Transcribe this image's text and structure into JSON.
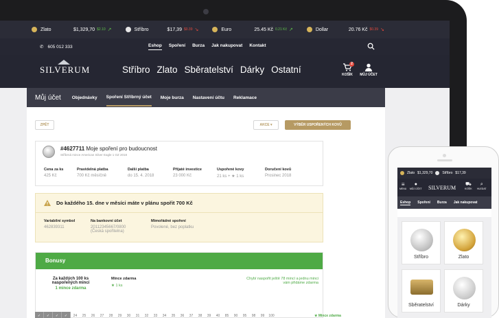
{
  "ticker": [
    {
      "name": "Zlato",
      "price": "$1,329,70",
      "change": "$2.10",
      "dir": "up",
      "color": "#d6b45a"
    },
    {
      "name": "Stříbro",
      "price": "$17,39",
      "change": "$0.39",
      "dir": "down",
      "color": "#e7e7e7"
    },
    {
      "name": "Euro",
      "price": "25.45 Kč",
      "change": "0.21 Kč",
      "dir": "up",
      "color": "#d6b45a"
    },
    {
      "name": "Dollar",
      "price": "20.76 Kč",
      "change": "$0.39",
      "dir": "down",
      "color": "#d6b45a"
    }
  ],
  "topnav": {
    "phone": "605 012 333",
    "links": [
      "Eshop",
      "Spoření",
      "Burza",
      "Jak nakupovat",
      "Kontakt"
    ]
  },
  "header": {
    "logo": "SILVERUM",
    "categories": [
      "Stříbro",
      "Zlato",
      "Sběratelství",
      "Dárky",
      "Ostatní"
    ],
    "cart_label": "KOŠÍK",
    "cart_count": "2",
    "account_label": "MŮJ ÚČET"
  },
  "subnav": {
    "title": "Můj účet",
    "items": [
      "Objednávky",
      "Spoření Stříbrný účet",
      "Moje burza",
      "Nastavení účtu",
      "Reklamace"
    ]
  },
  "panel": {
    "back": "ZPĚT",
    "action": "AKCE ▾",
    "select_coins": "VÝBĚR USPOŘENÝCH KOVŮ",
    "plan_id": "#4627711",
    "plan_title": "Moje spoření pro budoucnost",
    "plan_sub": "Stříbrná mince American Silver Eagle 1 OZ 2018",
    "stats": [
      {
        "label": "Cena za ks",
        "value": "425 Kč"
      },
      {
        "label": "Pravidelná platba",
        "value": "700 Kč měsíčně"
      },
      {
        "label": "Další platba",
        "value": "do 15. 4. 2018"
      },
      {
        "label": "Přijaté investice",
        "value": "23 000 Kč"
      },
      {
        "label": "Uspořené kovy",
        "value": "21 ks + ★ 1 ks"
      },
      {
        "label": "Doručení kovů",
        "value": "Prosinec 2018"
      }
    ],
    "alert_text": "Do každého 15. dne v měsíci máte v plánu spořit 700 Kč",
    "alert_fields": [
      {
        "label": "Variabilní symbol",
        "value": "462839311"
      },
      {
        "label": "Na bankovní účet",
        "value": "20112345667/0800 (Česká spořitelna)"
      },
      {
        "label": "Mimořádné spoření",
        "value": "Povolené, bez poplatku"
      }
    ],
    "bonus_title": "Bonusy",
    "bonus_rule": "Za každých 100 ks naspořených mincí",
    "bonus_rule_value": "1 mince zdarma",
    "bonus_free_label": "Mince zdarma",
    "bonus_free_value": "★ 1 ks",
    "bonus_note": "Chybí naspořit ještě 78 mincí a jednu minci vám přidáme zdarma",
    "bonus_free_tag": "★ Mince zdarma",
    "bonus_numbers": [
      "✓",
      "✓",
      "✓",
      "✓",
      "24",
      "25",
      "26",
      "27",
      "28",
      "29",
      "30",
      "31",
      "32",
      "33",
      "34",
      "35",
      "36",
      "37",
      "38",
      "39",
      "40",
      "85",
      "90",
      "95",
      "98",
      "99",
      "100"
    ]
  },
  "phone": {
    "ticker": [
      {
        "name": "Zlato",
        "price": "$1,329,70"
      },
      {
        "name": "Stříbro",
        "price": "$17,39"
      }
    ],
    "icons": [
      "MENU",
      "MŮJ ÚČET",
      "KOŠÍK",
      "HLEDAT"
    ],
    "logo": "SILVERUM",
    "nav": [
      "Eshop",
      "Spoření",
      "Burza",
      "Jak nakupovat"
    ],
    "tiles": [
      "Stříbro",
      "Zlato",
      "Sběratelství",
      "Dárky"
    ]
  }
}
